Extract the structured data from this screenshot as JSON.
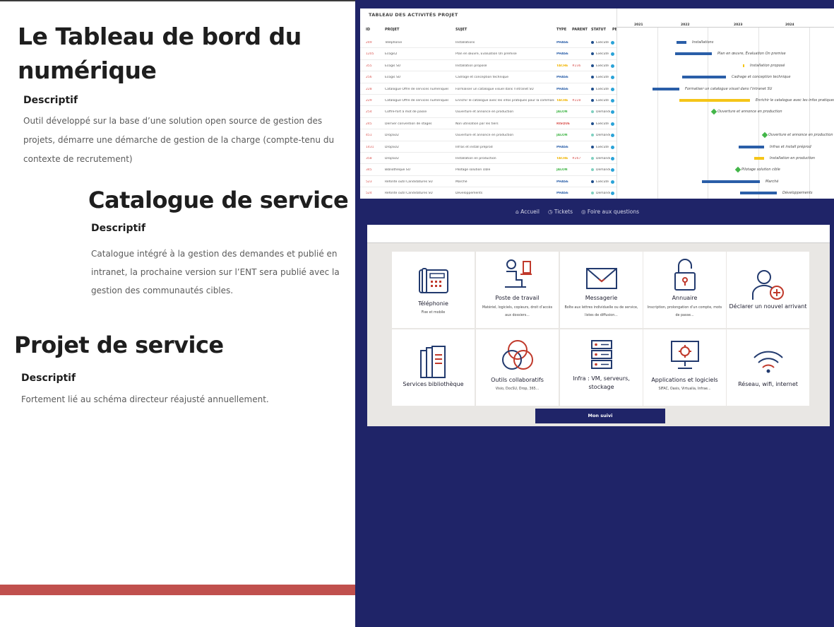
{
  "sections": [
    {
      "title": "Le Tableau de bord du numérique",
      "title_line1": "Le Tableau de bord du",
      "title_line2": "numérique",
      "subtitle": "Descriptif",
      "text_line1": "Outil développé sur la base d’une solution open source de gestion des",
      "text_line2": "projets, démarre une démarche de gestion de la charge (compte-tenu du",
      "text_line3": "contexte de recrutement)"
    },
    {
      "title": "Catalogue de service",
      "subtitle": "Descriptif",
      "text_line1": "Catalogue intégré à la gestion des demandes et publié en",
      "text_line2": "intranet, la prochaine version sur l’ENT sera publié avec la",
      "text_line3": "gestion des communautés cibles."
    },
    {
      "title": "Projet de service",
      "subtitle": "Descriptif",
      "text_line1": "Fortement lié au schéma directeur réajusté annuellement."
    }
  ],
  "colors": {
    "navy": "#1f2468",
    "accent_red": "#c0504d",
    "bar_blue": "#2a5ea8",
    "bar_yellow": "#f5c518",
    "milestone_green": "#43b649"
  },
  "gantt": {
    "title": "TABLEAU DES ACTIVITÉS PROJET",
    "headers": {
      "id": "ID",
      "projet": "PROJET",
      "sujet": "SUJET",
      "type": "TYPE",
      "parent": "PARENT",
      "statut": "STATUT",
      "pe": "PE"
    },
    "years": [
      "2021",
      "2022",
      "2023",
      "2024"
    ],
    "rows": [
      {
        "id": "249",
        "projet": "Téléphonie",
        "sujet": "Installations",
        "type": "PHASE",
        "parent": "",
        "statut": "Exécuté",
        "label": "Installations"
      },
      {
        "id": "1205",
        "projet": "Ecogis2",
        "sujet": "Plan en œuvre, Évaluation On premise",
        "type": "PHASE",
        "parent": "",
        "statut": "Exécuté",
        "label": "Plan en œuvre, Évaluation On premise"
      },
      {
        "id": "355",
        "projet": "Ecogis SU",
        "sujet": "Installation proposé",
        "type": "TÂCHE",
        "parent": "#236",
        "statut": "Exécuté",
        "label": "Installation proposé"
      },
      {
        "id": "256",
        "projet": "Ecogis SU",
        "sujet": "Cadrage et conception technique",
        "type": "PHASE",
        "parent": "",
        "statut": "Exécuté",
        "label": "Cadrage et conception technique"
      },
      {
        "id": "228",
        "projet": "Catalogue Offre de services numériques SU",
        "sujet": "Formaliser un catalogue visuel dans l’intranet SU",
        "type": "PHASE",
        "parent": "",
        "statut": "Exécuté",
        "label": "Formaliser un catalogue visuel dans l’intranet SU"
      },
      {
        "id": "229",
        "projet": "Catalogue Offre de services numériques SU",
        "sujet": "Enrichir le catalogue avec les infos pratiques pour la commande",
        "type": "TÂCHE",
        "parent": "#228",
        "statut": "Exécuté",
        "label": "Enrichir le catalogue avec les infos pratiques"
      },
      {
        "id": "254",
        "projet": "Coffre-fort à mot de passe",
        "sujet": "Ouverture et annonce en production",
        "type": "JALON",
        "parent": "",
        "statut": "Demandé",
        "label": "Ouverture et annonce en production"
      },
      {
        "id": "245",
        "projet": "Dernier convention de stages",
        "sujet": "Non utilisation par les tiers",
        "type": "RISQUE",
        "parent": "",
        "statut": "Exécuté",
        "label": ""
      },
      {
        "id": "451",
        "projet": "DropSU2",
        "sujet": "Ouverture et annonce en production",
        "type": "JALON",
        "parent": "",
        "statut": "Demandé",
        "label": "Ouverture et annonce en production"
      },
      {
        "id": "1431",
        "projet": "DropSU2",
        "sujet": "Infras et install préprod",
        "type": "PHASE",
        "parent": "",
        "statut": "Exécuté",
        "label": "Infras et install préprod"
      },
      {
        "id": "358",
        "projet": "DropSU2",
        "sujet": "Installation en production",
        "type": "TÂCHE",
        "parent": "#267",
        "statut": "Demandé",
        "label": "Installation en production"
      },
      {
        "id": "345",
        "projet": "Bibliothèque SU",
        "sujet": "Pilotage solution cible",
        "type": "JALON",
        "parent": "",
        "statut": "Demandé",
        "label": "Pilotage solution cible"
      },
      {
        "id": "523",
        "projet": "Refonte outil Candidatures SU",
        "sujet": "Marché",
        "type": "PHASE",
        "parent": "",
        "statut": "Exécuté",
        "label": "Marché"
      },
      {
        "id": "524",
        "projet": "Refonte outil Candidatures SU",
        "sujet": "Développements",
        "type": "PHASE",
        "parent": "",
        "statut": "Demandé",
        "label": "Développements"
      }
    ]
  },
  "portal": {
    "nav": {
      "home": "Accueil",
      "tickets": "Tickets",
      "faq": "Foire aux questions"
    },
    "tiles": [
      {
        "title": "Téléphonie",
        "sub": "Fixe et mobile",
        "icon": "phone-icon"
      },
      {
        "title": "Poste de travail",
        "sub": "Matériel, logiciels, copieurs, droit d’accès aux dossiers...",
        "icon": "workstation-icon"
      },
      {
        "title": "Messagerie",
        "sub": "Boîte aux lettres individuelle ou de service, listes de diffusion...",
        "icon": "envelope-icon"
      },
      {
        "title": "Annuaire",
        "sub": "Inscription, prolongation d’un compte, mots de passe...",
        "icon": "padlock-icon"
      },
      {
        "title": "Déclarer un nouvel arrivant",
        "sub": "",
        "icon": "add-user-icon"
      },
      {
        "title": "Services bibliothèque",
        "sub": "",
        "icon": "books-icon"
      },
      {
        "title": "Outils collaboratifs",
        "sub": "Visio, DocSU, Drop, 365...",
        "icon": "circles-icon"
      },
      {
        "title": "Infra : VM, serveurs, stockage",
        "sub": "",
        "icon": "server-icon"
      },
      {
        "title": "Applications et logiciels",
        "sub": "SIFAC, Oasis, Virtualia, Infrae...",
        "icon": "monitor-gear-icon"
      },
      {
        "title": "Réseau, wifi, internet",
        "sub": "",
        "icon": "wifi-icon"
      }
    ],
    "button": "Mon suivi"
  }
}
